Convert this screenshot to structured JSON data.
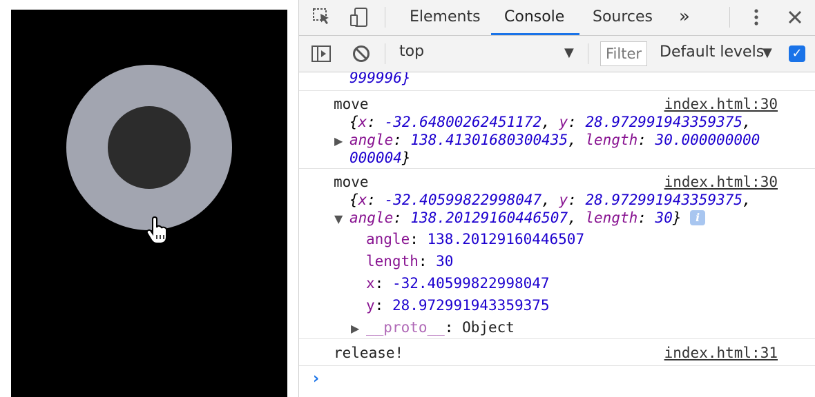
{
  "tabs": {
    "elements": "Elements",
    "console": "Console",
    "sources": "Sources",
    "more": "»"
  },
  "toolbar": {
    "context": "top",
    "filter_placeholder": "Filter",
    "levels": "Default levels"
  },
  "messages": {
    "partial_tail": "999996}",
    "move1": {
      "label": "move",
      "source": "index.html:30",
      "x": "-32.64800262451172",
      "y": "28.972991943359375",
      "angle": "138.41301680300435",
      "length_a": "30.000000000",
      "length_b": "000004"
    },
    "move2": {
      "label": "move",
      "source": "index.html:30",
      "x": "-32.40599822998047",
      "y": "28.972991943359375",
      "angle": "138.20129160446507",
      "length": "30",
      "expanded": {
        "angle": "138.20129160446507",
        "length": "30",
        "x": "-32.40599822998047",
        "y": "28.972991943359375",
        "proto_key": "__proto__",
        "proto_val": "Object"
      }
    },
    "release": {
      "label": "release!",
      "source": "index.html:31"
    }
  },
  "colors": {
    "accent": "#1a73e8",
    "ring": "#a2a5b0",
    "knob": "#2c2c2c",
    "property": "#881391",
    "number": "#1c00cf"
  }
}
